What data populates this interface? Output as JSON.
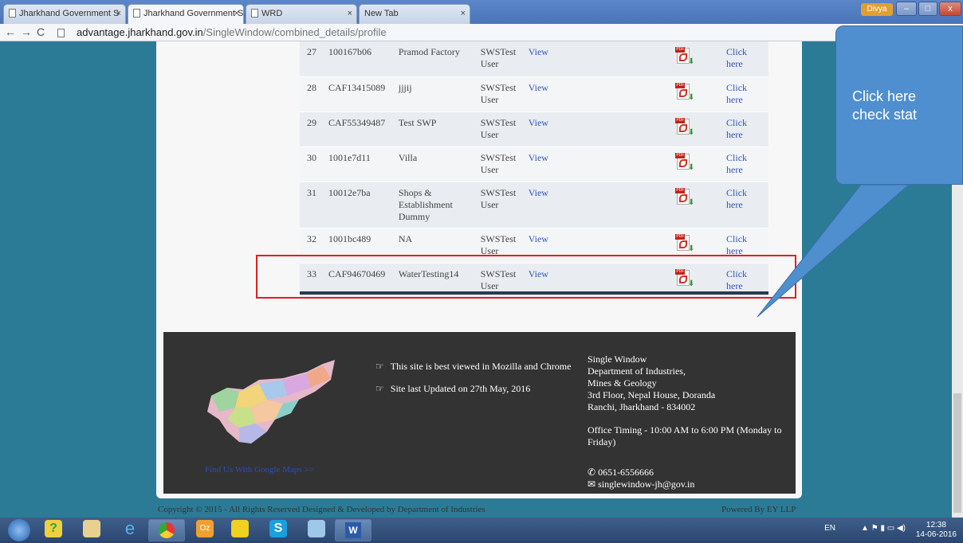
{
  "browser": {
    "tabs": [
      {
        "label": "Jharkhand Government S",
        "active": false
      },
      {
        "label": "Jharkhand Government S",
        "active": true
      },
      {
        "label": "WRD",
        "active": false
      },
      {
        "label": "New Tab",
        "active": false
      }
    ],
    "user_badge": "Divya",
    "url_domain": "advantage.jharkhand.gov.in",
    "url_path": "/SingleWindow/combined_details/profile"
  },
  "table": {
    "rows": [
      {
        "no": "27",
        "id": "100167b06",
        "name": "Pramod Factory",
        "by": "SWSTest User",
        "view": "View",
        "status": "Click here"
      },
      {
        "no": "28",
        "id": "CAF13415089",
        "name": "jjjij",
        "by": "SWSTest User",
        "view": "View",
        "status": "Click here"
      },
      {
        "no": "29",
        "id": "CAF55349487",
        "name": "Test SWP",
        "by": "SWSTest User",
        "view": "View",
        "status": "Click here"
      },
      {
        "no": "30",
        "id": "1001e7d11",
        "name": "Villa",
        "by": "SWSTest User",
        "view": "View",
        "status": "Click here"
      },
      {
        "no": "31",
        "id": "10012e7ba",
        "name": "Shops & Establishment Dummy",
        "by": "SWSTest User",
        "view": "View",
        "status": "Click here"
      },
      {
        "no": "32",
        "id": "1001bc489",
        "name": "NA",
        "by": "SWSTest User",
        "view": "View",
        "status": "Click here"
      },
      {
        "no": "33",
        "id": "CAF94670469",
        "name": "WaterTesting14",
        "by": "SWSTest User",
        "view": "View",
        "status": "Click here"
      }
    ]
  },
  "footer": {
    "map_link": "Find Us With Google Maps >>",
    "note_browser": "This site is best viewed in Mozilla and Chrome",
    "note_updated": "Site last Updated on 27th May, 2016",
    "address": [
      "Single Window",
      "Department of Industries,",
      "Mines & Geology",
      "3rd Floor, Nepal House, Doranda",
      "Ranchi, Jharkhand - 834002"
    ],
    "timing": "Office Timing - 10:00 AM to 6:00 PM (Monday to Friday)",
    "phone": "0651-6556666",
    "email": "singlewindow-jh@gov.in",
    "copyright": "Copyright © 2015 - All Rights Reserved   Designed & Developed by Department of Industries",
    "powered": "Powered By EY LLP"
  },
  "callout": {
    "line1": "Click here",
    "line2": "check stat"
  },
  "taskbar": {
    "lang": "EN",
    "time": "12:38",
    "date": "14-06-2016"
  },
  "colors": {
    "page_bg": "#2b7b96",
    "link": "#3355bb",
    "highlight": "#e02020",
    "callout": "#4f8fcf"
  }
}
